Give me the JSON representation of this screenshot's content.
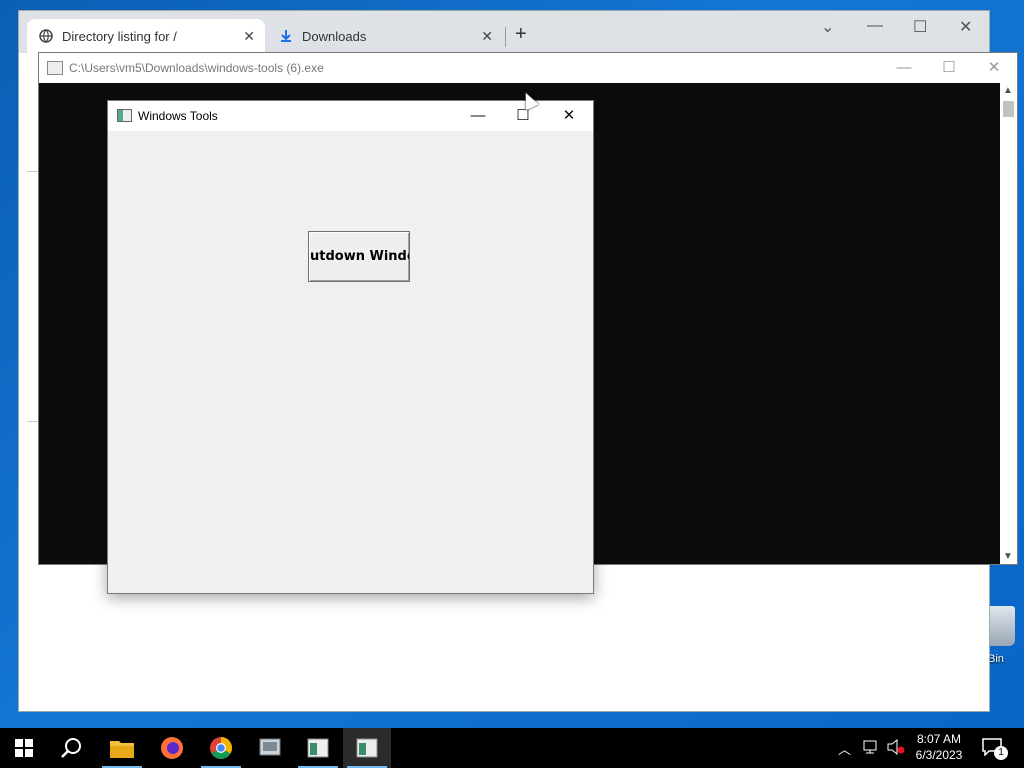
{
  "browser": {
    "tabs": [
      {
        "label": "Directory listing for /",
        "icon": "globe-icon",
        "close": "✕"
      },
      {
        "label": "Downloads",
        "icon": "download-icon",
        "close": "✕"
      }
    ],
    "new_tab": "+",
    "controls": {
      "dropdown": "⌄",
      "minimize": "—",
      "maximize": "☐",
      "close": "✕"
    }
  },
  "console": {
    "title": "C:\\Users\\vm5\\Downloads\\windows-tools (6).exe",
    "controls": {
      "minimize": "—",
      "maximize": "☐",
      "close": "✕"
    }
  },
  "tk_window": {
    "title": "Windows Tools",
    "controls": {
      "minimize": "—",
      "maximize": "☐",
      "close": "✕"
    },
    "button_label": "utdown Windo"
  },
  "taskbar": {
    "apps": [
      "start",
      "search",
      "file-explorer",
      "firefox",
      "chrome",
      "app-1",
      "app-2",
      "tk-app"
    ],
    "time": "8:07 AM",
    "date": "6/3/2023",
    "notification_count": "1"
  },
  "desktop": {
    "recycle_label": "Bin"
  },
  "colors": {
    "desktop": "#0a6fc2",
    "taskbar": "#000000",
    "console_bg": "#0c0c0c",
    "tk_bg": "#f0f0f0"
  }
}
